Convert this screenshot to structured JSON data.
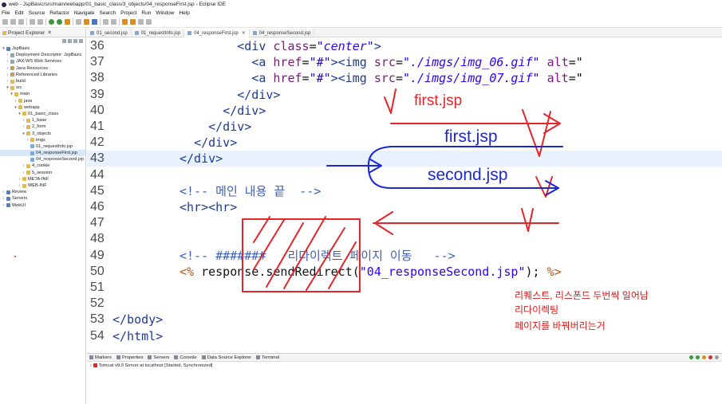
{
  "window": {
    "title": "web - JspBasic/src/main/webapp/01_basic_class/3_objects/04_responseFirst.jsp - Eclipse IDE"
  },
  "menu": [
    "File",
    "Edit",
    "Source",
    "Refactor",
    "Navigate",
    "Search",
    "Project",
    "Run",
    "Window",
    "Help"
  ],
  "explorer": {
    "tab_label": "Project Explorer",
    "items": [
      {
        "label": "JspBasic",
        "depth": 0,
        "arrow": "▾",
        "icon": "proj"
      },
      {
        "label": "Deployment Descriptor: JspBasic",
        "depth": 1,
        "arrow": "›",
        "icon": "file"
      },
      {
        "label": "JAX-WS Web Services",
        "depth": 1,
        "arrow": "›",
        "icon": "file"
      },
      {
        "label": "Java Resources",
        "depth": 1,
        "arrow": "›",
        "icon": "lib"
      },
      {
        "label": "Referenced Libraries",
        "depth": 1,
        "arrow": "›",
        "icon": "lib"
      },
      {
        "label": "build",
        "depth": 1,
        "arrow": "›",
        "icon": "folder"
      },
      {
        "label": "src",
        "depth": 1,
        "arrow": "▾",
        "icon": "folder"
      },
      {
        "label": "main",
        "depth": 2,
        "arrow": "▾",
        "icon": "folder"
      },
      {
        "label": "java",
        "depth": 3,
        "arrow": "›",
        "icon": "folder"
      },
      {
        "label": "webapp",
        "depth": 3,
        "arrow": "▾",
        "icon": "folder"
      },
      {
        "label": "01_basic_class",
        "depth": 4,
        "arrow": "▾",
        "icon": "folder"
      },
      {
        "label": "1_base",
        "depth": 5,
        "arrow": "›",
        "icon": "folder"
      },
      {
        "label": "2_form",
        "depth": 5,
        "arrow": "›",
        "icon": "folder"
      },
      {
        "label": "3_objects",
        "depth": 5,
        "arrow": "▾",
        "icon": "folder"
      },
      {
        "label": "imgs",
        "depth": 6,
        "arrow": "›",
        "icon": "folder"
      },
      {
        "label": "01_requestInfo.jsp",
        "depth": 6,
        "arrow": "",
        "icon": "jsp"
      },
      {
        "label": "04_responseFirst.jsp",
        "depth": 6,
        "arrow": "",
        "icon": "jsp",
        "selected": true
      },
      {
        "label": "04_responseSecond.jsp",
        "depth": 6,
        "arrow": "",
        "icon": "jsp"
      },
      {
        "label": "4_cookie",
        "depth": 5,
        "arrow": "›",
        "icon": "folder"
      },
      {
        "label": "5_session",
        "depth": 5,
        "arrow": "›",
        "icon": "folder"
      },
      {
        "label": "META-INF",
        "depth": 4,
        "arrow": "›",
        "icon": "folder"
      },
      {
        "label": "WEB-INF",
        "depth": 4,
        "arrow": "›",
        "icon": "folder"
      },
      {
        "label": "Review",
        "depth": 0,
        "arrow": "›",
        "icon": "proj"
      },
      {
        "label": "Servers",
        "depth": 0,
        "arrow": "›",
        "icon": "proj"
      },
      {
        "label": "WebUI",
        "depth": 0,
        "arrow": "›",
        "icon": "proj"
      }
    ]
  },
  "editor_tabs": [
    {
      "label": "01_second.jsp",
      "active": false
    },
    {
      "label": "01_requestInfo.jsp",
      "active": false
    },
    {
      "label": "04_responseFirst.jsp",
      "active": true
    },
    {
      "label": "04_responseSecond.jsp",
      "active": false
    }
  ],
  "code": {
    "lines": [
      {
        "n": "36",
        "indent": "        ",
        "tokens": [
          [
            "tag",
            "<div "
          ],
          [
            "attr",
            "class"
          ],
          [
            "txt",
            "="
          ],
          [
            "val",
            "\"center\""
          ],
          [
            "tag",
            ">"
          ]
        ]
      },
      {
        "n": "37",
        "indent": "          ",
        "tokens": [
          [
            "tag",
            "<a "
          ],
          [
            "attr",
            "href"
          ],
          [
            "txt",
            "="
          ],
          [
            "val",
            "\"#\""
          ],
          [
            "tag",
            "><img "
          ],
          [
            "attr",
            "src"
          ],
          [
            "txt",
            "="
          ],
          [
            "val",
            "\"./imgs/img_06.gif\""
          ],
          [
            "txt",
            " "
          ],
          [
            "attr",
            "alt"
          ],
          [
            "txt",
            "=\""
          ]
        ]
      },
      {
        "n": "38",
        "indent": "          ",
        "tokens": [
          [
            "tag",
            "<a "
          ],
          [
            "attr",
            "href"
          ],
          [
            "txt",
            "="
          ],
          [
            "val",
            "\"#\""
          ],
          [
            "tag",
            "><img "
          ],
          [
            "attr",
            "src"
          ],
          [
            "txt",
            "="
          ],
          [
            "val",
            "\"./imgs/img_07.gif\""
          ],
          [
            "txt",
            " "
          ],
          [
            "attr",
            "alt"
          ],
          [
            "txt",
            "=\""
          ]
        ]
      },
      {
        "n": "39",
        "indent": "        ",
        "tokens": [
          [
            "tag",
            "</div>"
          ]
        ]
      },
      {
        "n": "40",
        "indent": "      ",
        "tokens": [
          [
            "tag",
            "</div>"
          ]
        ]
      },
      {
        "n": "41",
        "indent": "    ",
        "tokens": [
          [
            "tag",
            "</div>"
          ]
        ]
      },
      {
        "n": "42",
        "indent": "  ",
        "tokens": [
          [
            "tag",
            "</div>"
          ]
        ]
      },
      {
        "n": "43",
        "indent": "",
        "tokens": [
          [
            "tag",
            "</div>"
          ]
        ],
        "current": true
      },
      {
        "n": "44",
        "indent": "",
        "tokens": []
      },
      {
        "n": "45",
        "indent": "",
        "tokens": [
          [
            "com",
            "<!-- 메인 내용 끝  -->"
          ]
        ]
      },
      {
        "n": "46",
        "indent": "",
        "tokens": [
          [
            "tag",
            "<hr><hr>"
          ]
        ]
      },
      {
        "n": "47",
        "indent": "",
        "tokens": []
      },
      {
        "n": "48",
        "indent": "",
        "tokens": []
      },
      {
        "n": "49",
        "indent": "",
        "tokens": [
          [
            "com",
            "<!-- #######   리다이렉트 페이지 이동   -->"
          ]
        ]
      },
      {
        "n": "50",
        "indent": "",
        "tokens": [
          [
            "jsp",
            "<%"
          ],
          [
            "txt",
            " response.sendRedirect("
          ],
          [
            "str",
            "\"04_responseSecond.jsp\""
          ],
          [
            "txt",
            "); "
          ],
          [
            "jsp",
            "%>"
          ]
        ]
      },
      {
        "n": "51",
        "indent": "",
        "tokens": []
      },
      {
        "n": "52",
        "indent": "",
        "tokens": []
      },
      {
        "n": "53",
        "indent": "",
        "tokens": [
          [
            "tag",
            "</body>"
          ]
        ],
        "base": true
      },
      {
        "n": "54",
        "indent": "",
        "tokens": [
          [
            "tag",
            "</html>"
          ]
        ],
        "base": true
      }
    ]
  },
  "annotations": {
    "first_red": "first.jsp",
    "first_blue": "first.jsp",
    "second_blue": "second.jsp",
    "note_lines": [
      "리퀘스트, 리스폰드 두번씩 일어남",
      "리다이렉팅",
      "페이지를 바꿔버리는거"
    ]
  },
  "bottom_panel": {
    "tabs": [
      "Markers",
      "Properties",
      "Servers",
      "Console",
      "Data Source Explorer",
      "Terminal"
    ],
    "server": "Tomcat v9.0 Server at localhost  [Started, Synchronized]"
  },
  "colors": {
    "annotation_red": "#e3262c",
    "annotation_blue": "#1c27d4",
    "current_line": "#e8f2fe"
  }
}
